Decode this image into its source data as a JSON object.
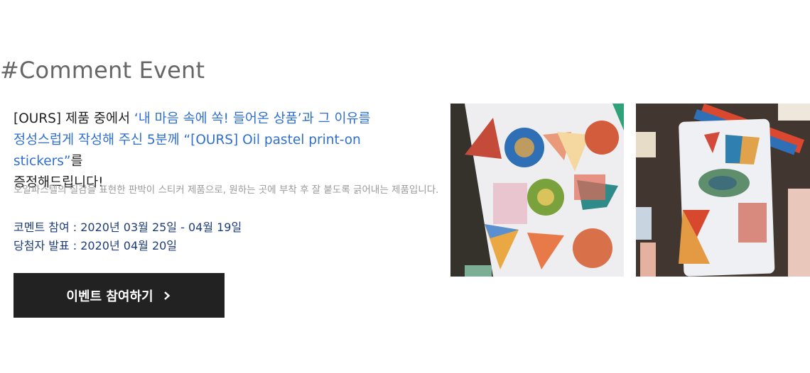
{
  "section": {
    "title": "#Comment Event"
  },
  "intro": {
    "line1_prefix": "[OURS] 제품 중에서 ",
    "line1_highlight": "‘내 마음 속에 쏙! 들어온 상품’과 그 이유를",
    "line2_highlight": "정성스럽게 작성해 주신 5분께 “[OURS] Oil pastel print-on stickers”",
    "line2_suffix": "를",
    "line3": "증정해드립니다!"
  },
  "description": "오일파스텔의 질감을 표현한 판박이 스티커 제품으로, 원하는 곳에 부착 후 잘 붙도록 긁어내는 제품입니다.",
  "schedule": {
    "comment_period": "코멘트 참여 : 2020년 03월 25일 - 04월 19일",
    "announcement": "당첨자 발표 : 2020년 04월 20일"
  },
  "cta": {
    "label": "이벤트 참여하기",
    "icon": "chevron-right-icon"
  },
  "images": {
    "first": "sticker-sheet-photo",
    "second": "sticker-on-paper-photo"
  },
  "colors": {
    "highlight": "#2f6fd3",
    "schedule_text": "#1d3c7a",
    "button_bg": "#222222"
  }
}
